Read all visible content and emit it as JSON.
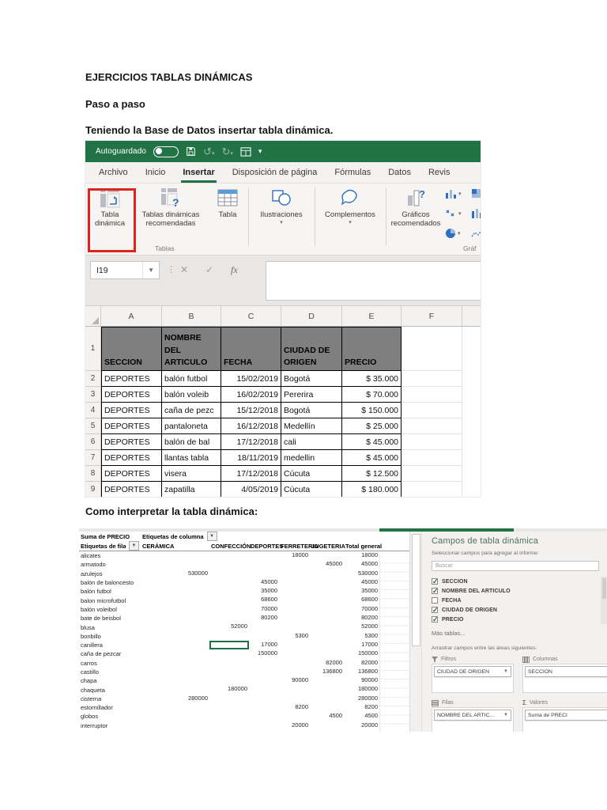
{
  "page": {
    "title": "EJERCICIOS TABLAS DINÁMICAS",
    "step": "Paso a paso",
    "instruction": "Teniendo la Base de Datos insertar tabla dinámica.",
    "interpret": "Como interpretar la tabla dinámica:"
  },
  "excel1": {
    "autosave": "Autoguardado",
    "menu_tabs": [
      "Archivo",
      "Inicio",
      "Insertar",
      "Disposición de página",
      "Fórmulas",
      "Datos",
      "Revis"
    ],
    "active_tab": 2,
    "ribbon": {
      "pivot": "Tabla dinámica",
      "rec_pivots": "Tablas dinámicas recomendadas",
      "table_btn": "Tabla",
      "group_tables": "Tablas",
      "illustrations": "Ilustraciones",
      "addins": "Complementos",
      "rec_charts": "Gráficos recomendados",
      "group_charts": "Gráf"
    },
    "name_box": "I19",
    "fx": "fx",
    "column_headers": [
      "A",
      "B",
      "C",
      "D",
      "E",
      "F"
    ],
    "table": {
      "headers": [
        "SECCION",
        "NOMBRE DEL ARTICULO",
        "FECHA",
        "CIUDAD DE ORIGEN",
        "PRECIO"
      ],
      "rows": [
        {
          "n": "2",
          "cells": [
            "DEPORTES",
            "balón futbol",
            "15/02/2019",
            "Bogotá",
            "$ 35.000"
          ]
        },
        {
          "n": "3",
          "cells": [
            "DEPORTES",
            "balón voleib",
            "16/02/2019",
            "Pererira",
            "$ 70.000"
          ]
        },
        {
          "n": "4",
          "cells": [
            "DEPORTES",
            "caña de pezc",
            "15/12/2018",
            "Bogotá",
            "$ 150.000"
          ]
        },
        {
          "n": "5",
          "cells": [
            "DEPORTES",
            "pantaloneta",
            "16/12/2018",
            "Medellín",
            "$ 25.000"
          ]
        },
        {
          "n": "6",
          "cells": [
            "DEPORTES",
            "balón de bal",
            "17/12/2018",
            "cali",
            "$ 45.000"
          ]
        },
        {
          "n": "7",
          "cells": [
            "DEPORTES",
            "llantas tabla",
            "18/11/2019",
            "medellin",
            "$ 45.000"
          ]
        },
        {
          "n": "8",
          "cells": [
            "DEPORTES",
            "visera",
            "17/12/2018",
            "Cúcuta",
            "$ 12.500"
          ]
        },
        {
          "n": "9",
          "cells": [
            "DEPORTES",
            "zapatilla",
            "4/05/2019",
            "Cúcuta",
            "$ 180.000"
          ]
        }
      ]
    }
  },
  "pivot": {
    "corner": "Suma de PRECIO",
    "col_label": "Etiquetas de columna",
    "row_label": "Etiquetas de fila",
    "columns": [
      "CERÁMICA",
      "CONFECCIÓN",
      "DEPORTES",
      "FERRETERIA",
      "JUGETERIA",
      "Total general"
    ],
    "rows": [
      {
        "name": "alicates",
        "values": [
          "",
          "",
          "",
          "18000",
          "",
          "18000"
        ]
      },
      {
        "name": "armatodo",
        "values": [
          "",
          "",
          "",
          "",
          "45000",
          "45000"
        ]
      },
      {
        "name": "azulejos",
        "values": [
          "530000",
          "",
          "",
          "",
          "",
          "530000"
        ]
      },
      {
        "name": "balón de baloncesto",
        "values": [
          "",
          "",
          "45000",
          "",
          "",
          "45000"
        ]
      },
      {
        "name": "balón futbol",
        "values": [
          "",
          "",
          "35000",
          "",
          "",
          "35000"
        ]
      },
      {
        "name": "balon microfutbol",
        "values": [
          "",
          "",
          "68600",
          "",
          "",
          "68600"
        ]
      },
      {
        "name": "balón voleibol",
        "values": [
          "",
          "",
          "70000",
          "",
          "",
          "70000"
        ]
      },
      {
        "name": "bate de beisbol",
        "values": [
          "",
          "",
          "80200",
          "",
          "",
          "80200"
        ]
      },
      {
        "name": "blusa",
        "values": [
          "",
          "52000",
          "",
          "",
          "",
          "52000"
        ]
      },
      {
        "name": "bonbillo",
        "values": [
          "",
          "",
          "",
          "5300",
          "",
          "5300"
        ]
      },
      {
        "name": "canillera",
        "values": [
          "",
          "",
          "17000",
          "",
          "",
          "17000"
        ],
        "sel": 1
      },
      {
        "name": "caña de pezcar",
        "values": [
          "",
          "",
          "150000",
          "",
          "",
          "150000"
        ]
      },
      {
        "name": "carros",
        "values": [
          "",
          "",
          "",
          "",
          "82000",
          "82000"
        ]
      },
      {
        "name": "castillo",
        "values": [
          "",
          "",
          "",
          "",
          "136800",
          "136800"
        ]
      },
      {
        "name": "chapa",
        "values": [
          "",
          "",
          "",
          "90000",
          "",
          "90000"
        ]
      },
      {
        "name": "chaqueta",
        "values": [
          "",
          "180000",
          "",
          "",
          "",
          "180000"
        ]
      },
      {
        "name": "cisterna",
        "values": [
          "280000",
          "",
          "",
          "",
          "",
          "280000"
        ]
      },
      {
        "name": "estornillador",
        "values": [
          "",
          "",
          "",
          "8200",
          "",
          "8200"
        ]
      },
      {
        "name": "globos",
        "values": [
          "",
          "",
          "",
          "",
          "4500",
          "4500"
        ]
      },
      {
        "name": "interruptor",
        "values": [
          "",
          "",
          "",
          "20000",
          "",
          "20000"
        ]
      }
    ]
  },
  "fields_panel": {
    "title": "Campos de tabla dinámica",
    "subtitle": "Seleccionar campos para agregar al informe:",
    "search_placeholder": "Buscar",
    "fields": [
      {
        "label": "SECCION",
        "checked": true
      },
      {
        "label": "NOMBRE DEL ARTICULO",
        "checked": true
      },
      {
        "label": "FECHA",
        "checked": false
      },
      {
        "label": "CIUDAD DE ORIGEN",
        "checked": true
      },
      {
        "label": "PRECIO",
        "checked": true
      }
    ],
    "more_tables": "Más tablas...",
    "drag_hint": "Arrastrar campos entre las áreas siguientes:",
    "areas": {
      "filters": {
        "label": "Filtros",
        "item": "CIUDAD DE ORIGEN"
      },
      "columns": {
        "label": "Columnas",
        "item": "SECCION"
      },
      "rows": {
        "label": "Filas",
        "item": "NOMBRE DEL ARTIC..."
      },
      "values": {
        "label": "Valores",
        "item": "Suma de PRECI"
      }
    }
  }
}
